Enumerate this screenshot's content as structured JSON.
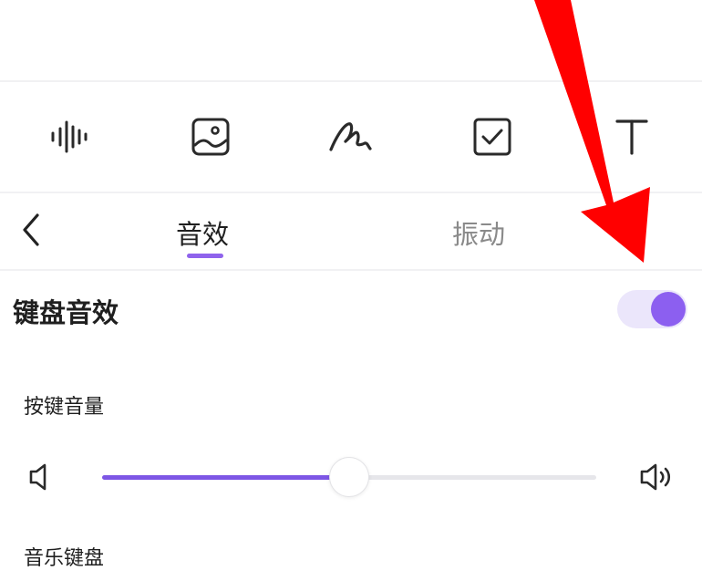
{
  "toolbar": {
    "items": [
      {
        "icon": "voice-waveform-icon"
      },
      {
        "icon": "image-icon"
      },
      {
        "icon": "handwriting-icon"
      },
      {
        "icon": "checkbox-icon"
      },
      {
        "icon": "text-icon"
      }
    ]
  },
  "tabs": {
    "back_icon": "chevron-left-icon",
    "items": [
      {
        "label": "音效",
        "active": true
      },
      {
        "label": "振动",
        "active": false
      }
    ]
  },
  "keyboard_sound": {
    "label": "键盘音效",
    "enabled": true
  },
  "key_volume": {
    "label": "按键音量",
    "value_fraction": 0.5,
    "low_icon": "volume-low-icon",
    "high_icon": "volume-high-icon"
  },
  "music_keyboard": {
    "label": "音乐键盘"
  },
  "colors": {
    "accent": "#8c5ff0",
    "slider_fill": "#7d56e5",
    "toggle_track": "#ebe6fb",
    "annotation_arrow": "#ff0000",
    "inactive_tab": "#8a8a8a"
  }
}
